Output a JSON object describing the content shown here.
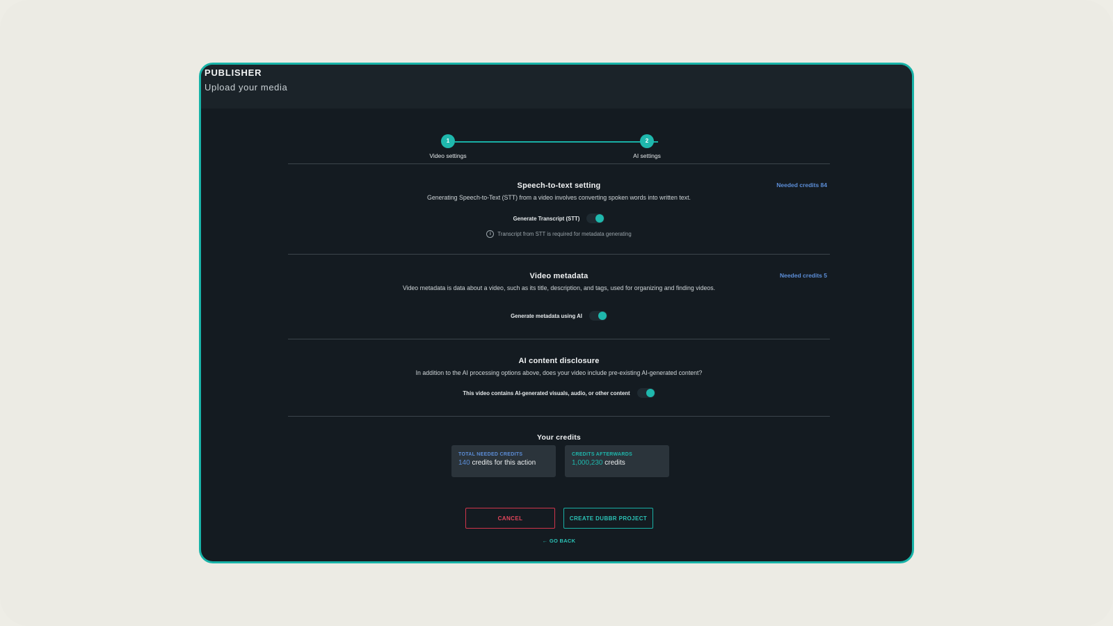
{
  "header": {
    "brand": "PUBLISHER",
    "subtitle": "Upload your media"
  },
  "stepper": {
    "steps": [
      {
        "number": "1",
        "label": "Video settings"
      },
      {
        "number": "2",
        "label": "AI settings"
      }
    ]
  },
  "stt": {
    "title": "Speech-to-text setting",
    "description": "Generating Speech-to-Text (STT) from a video involves converting spoken words into written text.",
    "needed_credits": "Needed credits 84",
    "toggle_label": "Generate Transcript (STT)",
    "toggle_on": true,
    "info": "Transcript from STT is required for metadata generating"
  },
  "metadata": {
    "title": "Video metadata",
    "description": "Video metadata is data about a video, such as its title, description, and tags, used for organizing and finding videos.",
    "needed_credits": "Needed credits 5",
    "toggle_label": "Generate metadata using AI",
    "toggle_on": true
  },
  "disclosure": {
    "title": "AI content disclosure",
    "description": "In addition to the AI processing options above, does your video include pre-existing AI-generated content?",
    "toggle_label": "This video contains AI-generated visuals, audio, or other content",
    "toggle_on": true
  },
  "credits": {
    "title": "Your credits",
    "total": {
      "caption": "TOTAL NEEDED CREDITS",
      "value": "140",
      "suffix": " credits for this action"
    },
    "after": {
      "caption": "CREDITS AFTERWARDS",
      "value": "1,000,230",
      "suffix": " credits"
    }
  },
  "actions": {
    "cancel": "CANCEL",
    "create": "CREATE DUBBR PROJECT",
    "go_back": "← GO BACK"
  },
  "colors": {
    "accent": "#1fb8ad",
    "link_blue": "#5c8ed8",
    "danger": "#e2455b",
    "panel": "#141b21"
  }
}
